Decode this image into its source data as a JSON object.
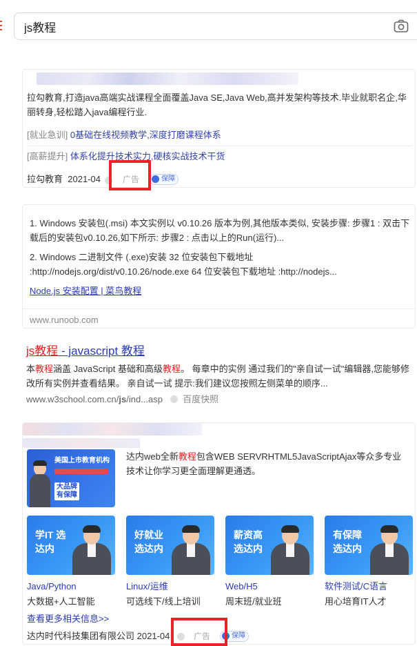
{
  "search": {
    "query": "js教程"
  },
  "results": [
    {
      "desc": "拉勾教育,打造java高端实战课程全面覆盖Java SE,Java Web,高并发架构等技术.毕业就职名企,华丽转身,轻松踏入java编程行业.",
      "sublinks": [
        {
          "bracket": "[就业急训]",
          "text": "0基础在线视频教学,深度打磨课程体系"
        },
        {
          "bracket": "[高薪提升]",
          "text": "体系化提升技术实力,硬核实战技术干货"
        }
      ],
      "source": "拉勾教育",
      "date": "2021-04",
      "ad": "广告",
      "ensure": "保障"
    },
    {
      "lines": [
        "1. Windows 安装包(.msi) 本文实例以 v0.10.26 版本为例,其他版本类似, 安装步骤: 步骤1 : 双击下载后的安装包v0.10.26,如下所示: 步骤2 : 点击以上的Run(运行)...",
        "2. Windows 二进制文件 (.exe)安装 32 位安装包下载地址 :http://nodejs.org/dist/v0.10.26/node.exe 64 位安装包下载地址 :http://nodejs..."
      ],
      "link": "Node.js 安装配置 | 菜鸟教程",
      "domain": "www.runoob.com"
    },
    {
      "title_hl": "js教程",
      "title_rest": " - javascript 教程",
      "desc_a": "本",
      "desc_hl": "教程",
      "desc_b": "涵盖 JavaScript 基础和高级",
      "desc_hl2": "教程",
      "desc_c": "。 每章中的实例 通过我们的\"亲自试一试\"编辑器,您能够修改所有实例并查看结果。 亲自试一试 提示:我们建议您按照左侧菜单的顺序...",
      "url_a": "www.w3school.com.cn/",
      "url_b": "js",
      "url_c": "/ind...asp",
      "snapshot": "百度快照"
    },
    {
      "desc_a": "达内web全新",
      "desc_hl": "教程",
      "desc_b": "包含WEB SERVRHTML5JavaScriptAjax等众多专业技术让你学习更全面理解更通透。",
      "main_banner": [
        "美国上市教育机构",
        "大品牌",
        "有保障"
      ],
      "courses": [
        {
          "banner": "学IT 选达内",
          "title": "Java/Python",
          "sub": "大数据+人工智能"
        },
        {
          "banner": "好就业 选达内",
          "title": "Linux/运维",
          "sub": "可选线下/线上培训"
        },
        {
          "banner": "薪资高 选达内",
          "title": "Web/H5",
          "sub": "周末班/就业班"
        },
        {
          "banner": "有保障 选达内",
          "title": "软件测试/C语言",
          "sub": "用心培育IT人才"
        }
      ],
      "more": "查看更多相关信息>>",
      "source": "达内时代科技集团有限公司",
      "date": "2021-04",
      "ad": "广告",
      "ensure": "保障"
    }
  ]
}
